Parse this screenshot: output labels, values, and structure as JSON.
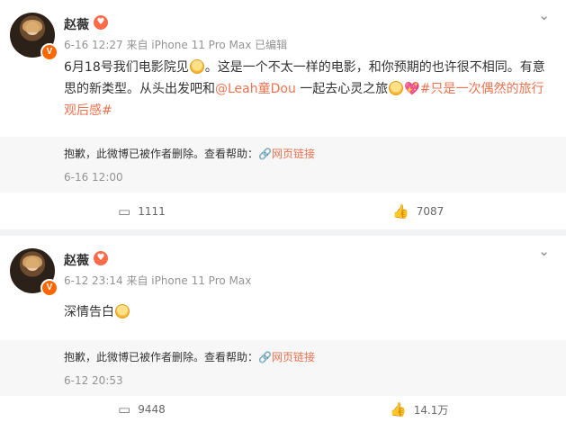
{
  "posts": [
    {
      "author": "赵薇",
      "avatar_badge": "V",
      "meta": "6-16 12:27 来自 iPhone 11 Pro Max 已编辑",
      "text": {
        "line1_a": "6月18号我们电影院见",
        "line1_b": "。这是一个不太一样的电影，和你预期的也许很不相同。有意",
        "line2_a": "思的新类型。从头出发吧和",
        "mention": "@Leah童Dou",
        "line2_b": " 一起去心灵之旅",
        "hashtag_a": "#只是一次偶然的旅行",
        "hashtag_b": "观后感#"
      },
      "repost": {
        "deleted_text": "抱歉，此微博已被作者删除。查看帮助：",
        "link_label": "网页链接",
        "date": "6-16 12:00"
      },
      "comments": "1111",
      "likes": "7087"
    },
    {
      "author": "赵薇",
      "avatar_badge": "V",
      "meta": "6-12 23:14 来自 iPhone 11 Pro Max",
      "text": {
        "body": "深情告白"
      },
      "repost": {
        "deleted_text": "抱歉，此微博已被作者删除。查看帮助：",
        "link_label": "网页链接",
        "date": "6-12 20:53"
      },
      "comments": "9448",
      "likes": "14.1万"
    }
  ],
  "icons": {
    "chevron": "⌄",
    "comment": "▭",
    "like": "👍",
    "link": "🔗"
  }
}
